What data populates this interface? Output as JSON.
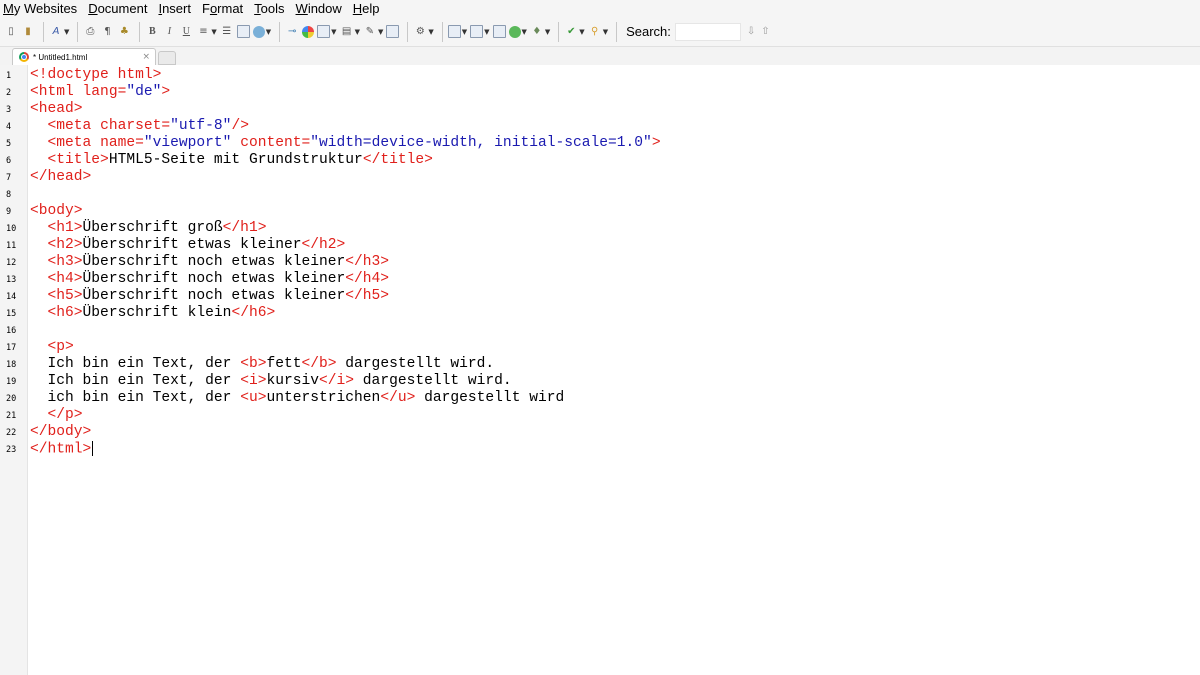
{
  "menu": [
    {
      "pre": "",
      "ul": "M",
      "post": "y Websites"
    },
    {
      "pre": "",
      "ul": "D",
      "post": "ocument"
    },
    {
      "pre": "",
      "ul": "I",
      "post": "nsert"
    },
    {
      "pre": "F",
      "ul": "o",
      "post": "rmat"
    },
    {
      "pre": "",
      "ul": "T",
      "post": "ools"
    },
    {
      "pre": "",
      "ul": "W",
      "post": "indow"
    },
    {
      "pre": "",
      "ul": "H",
      "post": "elp"
    }
  ],
  "toolbar": {
    "search_label": "Search:",
    "search_value": ""
  },
  "tab": {
    "title": "* Untitled1.html",
    "close": "×"
  },
  "editor": {
    "line_numbers": [
      "1",
      "2",
      "3",
      "4",
      "5",
      "6",
      "7",
      "8",
      "9",
      "10",
      "11",
      "12",
      "13",
      "14",
      "15",
      "16",
      "17",
      "18",
      "19",
      "20",
      "21",
      "22",
      "23"
    ],
    "lines": [
      [
        {
          "t": "<!doctype html>",
          "c": "tag"
        }
      ],
      [
        {
          "t": "<html ",
          "c": "tag"
        },
        {
          "t": "lang=",
          "c": "attr"
        },
        {
          "t": "\"de\"",
          "c": "val"
        },
        {
          "t": ">",
          "c": "tag"
        }
      ],
      [
        {
          "t": "<head>",
          "c": "tag"
        }
      ],
      [
        {
          "t": "  "
        },
        {
          "t": "<meta ",
          "c": "tag"
        },
        {
          "t": "charset=",
          "c": "attr"
        },
        {
          "t": "\"utf-8\"",
          "c": "val"
        },
        {
          "t": "/>",
          "c": "tag"
        }
      ],
      [
        {
          "t": "  "
        },
        {
          "t": "<meta ",
          "c": "tag"
        },
        {
          "t": "name=",
          "c": "attr"
        },
        {
          "t": "\"viewport\"",
          "c": "val"
        },
        {
          "t": " "
        },
        {
          "t": "content=",
          "c": "attr"
        },
        {
          "t": "\"width=device-width, initial-scale=1.0\"",
          "c": "val"
        },
        {
          "t": ">",
          "c": "tag"
        }
      ],
      [
        {
          "t": "  "
        },
        {
          "t": "<title>",
          "c": "tag"
        },
        {
          "t": "HTML5-Seite mit Grundstruktur"
        },
        {
          "t": "</title>",
          "c": "tag"
        }
      ],
      [
        {
          "t": "</head>",
          "c": "tag"
        }
      ],
      [],
      [
        {
          "t": "<body>",
          "c": "tag"
        }
      ],
      [
        {
          "t": "  "
        },
        {
          "t": "<h1>",
          "c": "tag"
        },
        {
          "t": "Überschrift groß"
        },
        {
          "t": "</h1>",
          "c": "tag"
        }
      ],
      [
        {
          "t": "  "
        },
        {
          "t": "<h2>",
          "c": "tag"
        },
        {
          "t": "Überschrift etwas kleiner"
        },
        {
          "t": "</h2>",
          "c": "tag"
        }
      ],
      [
        {
          "t": "  "
        },
        {
          "t": "<h3>",
          "c": "tag"
        },
        {
          "t": "Überschrift noch etwas kleiner"
        },
        {
          "t": "</h3>",
          "c": "tag"
        }
      ],
      [
        {
          "t": "  "
        },
        {
          "t": "<h4>",
          "c": "tag"
        },
        {
          "t": "Überschrift noch etwas kleiner"
        },
        {
          "t": "</h4>",
          "c": "tag"
        }
      ],
      [
        {
          "t": "  "
        },
        {
          "t": "<h5>",
          "c": "tag"
        },
        {
          "t": "Überschrift noch etwas kleiner"
        },
        {
          "t": "</h5>",
          "c": "tag"
        }
      ],
      [
        {
          "t": "  "
        },
        {
          "t": "<h6>",
          "c": "tag"
        },
        {
          "t": "Überschrift klein"
        },
        {
          "t": "</h6>",
          "c": "tag"
        }
      ],
      [],
      [
        {
          "t": "  "
        },
        {
          "t": "<p>",
          "c": "tag"
        }
      ],
      [
        {
          "t": "  Ich bin ein Text, der "
        },
        {
          "t": "<b>",
          "c": "tag"
        },
        {
          "t": "fett"
        },
        {
          "t": "</b>",
          "c": "tag"
        },
        {
          "t": " dargestellt wird."
        }
      ],
      [
        {
          "t": "  Ich bin ein Text, der "
        },
        {
          "t": "<i>",
          "c": "tag"
        },
        {
          "t": "kursiv"
        },
        {
          "t": "</i>",
          "c": "tag"
        },
        {
          "t": " dargestellt wird."
        }
      ],
      [
        {
          "t": "  ich bin ein Text, der "
        },
        {
          "t": "<u>",
          "c": "tag"
        },
        {
          "t": "unterstrichen"
        },
        {
          "t": "</u>",
          "c": "tag"
        },
        {
          "t": " dargestellt wird"
        }
      ],
      [
        {
          "t": "  "
        },
        {
          "t": "</p>",
          "c": "tag"
        }
      ],
      [
        {
          "t": "</body>",
          "c": "tag"
        }
      ],
      [
        {
          "t": "</html>",
          "c": "tag"
        }
      ]
    ],
    "cursor_line": 23
  }
}
